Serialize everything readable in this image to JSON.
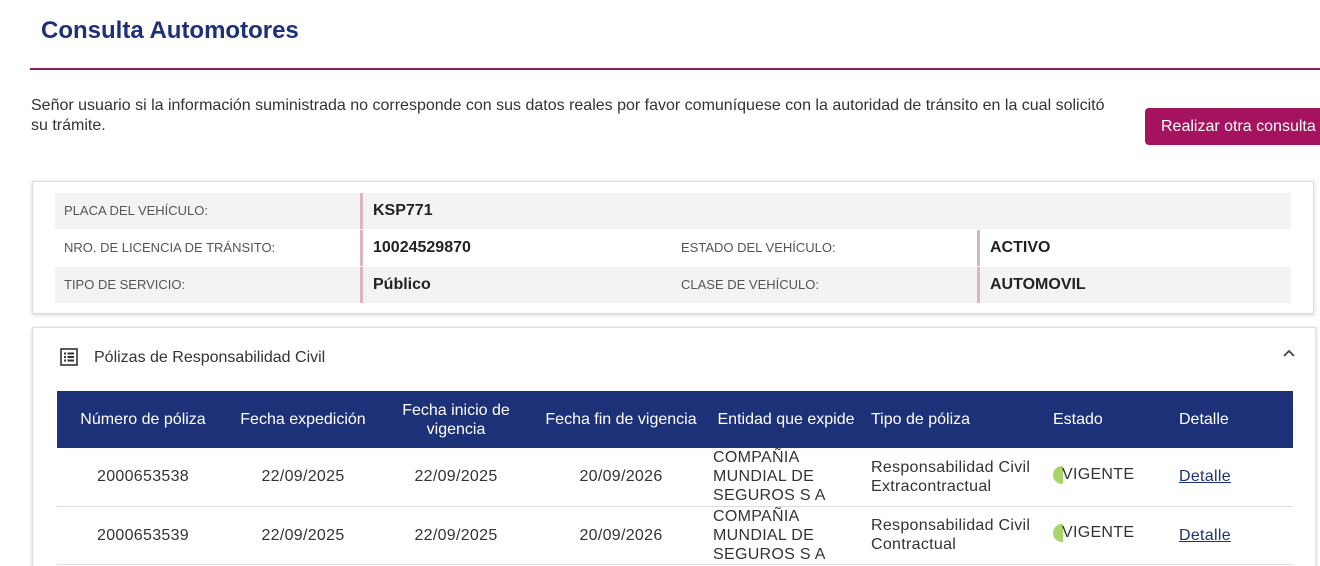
{
  "page": {
    "title": "Consulta Automotores",
    "notice": "Señor usuario si la información suministrada no corresponde con sus datos reales por favor comuníquese con la autoridad de tránsito en la cual solicitó su trámite.",
    "new_query_button": "Realizar otra consulta"
  },
  "vehicle": {
    "plate_label": "PLACA DEL VEHÍCULO:",
    "plate_value": "KSP771",
    "license_label": "NRO. DE LICENCIA DE TRÁNSITO:",
    "license_value": "10024529870",
    "state_label": "ESTADO DEL VEHÍCULO:",
    "state_value": "ACTIVO",
    "service_label": "TIPO DE SERVICIO:",
    "service_value": "Público",
    "class_label": "CLASE DE VEHÍCULO:",
    "class_value": "AUTOMOVIL"
  },
  "policies": {
    "section_title": "Pólizas de Responsabilidad Civil",
    "icons": {
      "section": "list-icon",
      "collapse": "chevron-up-icon"
    },
    "columns": [
      "Número de póliza",
      "Fecha expedición",
      "Fecha inicio de vigencia",
      "Fecha fin de vigencia",
      "Entidad que expide",
      "Tipo de póliza",
      "Estado",
      "Detalle"
    ],
    "rows": [
      {
        "number": "2000653538",
        "issued": "22/09/2025",
        "start": "22/09/2025",
        "end": "20/09/2026",
        "entity": "COMPAÑIA MUNDIAL DE SEGUROS S A",
        "type": "Responsabilidad Civil Extracontractual",
        "status": "VIGENTE",
        "detail": "Detalle"
      },
      {
        "number": "2000653539",
        "issued": "22/09/2025",
        "start": "22/09/2025",
        "end": "20/09/2026",
        "entity": "COMPAÑIA MUNDIAL DE SEGUROS S A",
        "type": "Responsabilidad Civil Contractual",
        "status": "VIGENTE",
        "detail": "Detalle"
      }
    ]
  },
  "colors": {
    "brand_blue": "#1d3178",
    "accent_magenta": "#a5135f",
    "status_green": "#a9d46b"
  }
}
